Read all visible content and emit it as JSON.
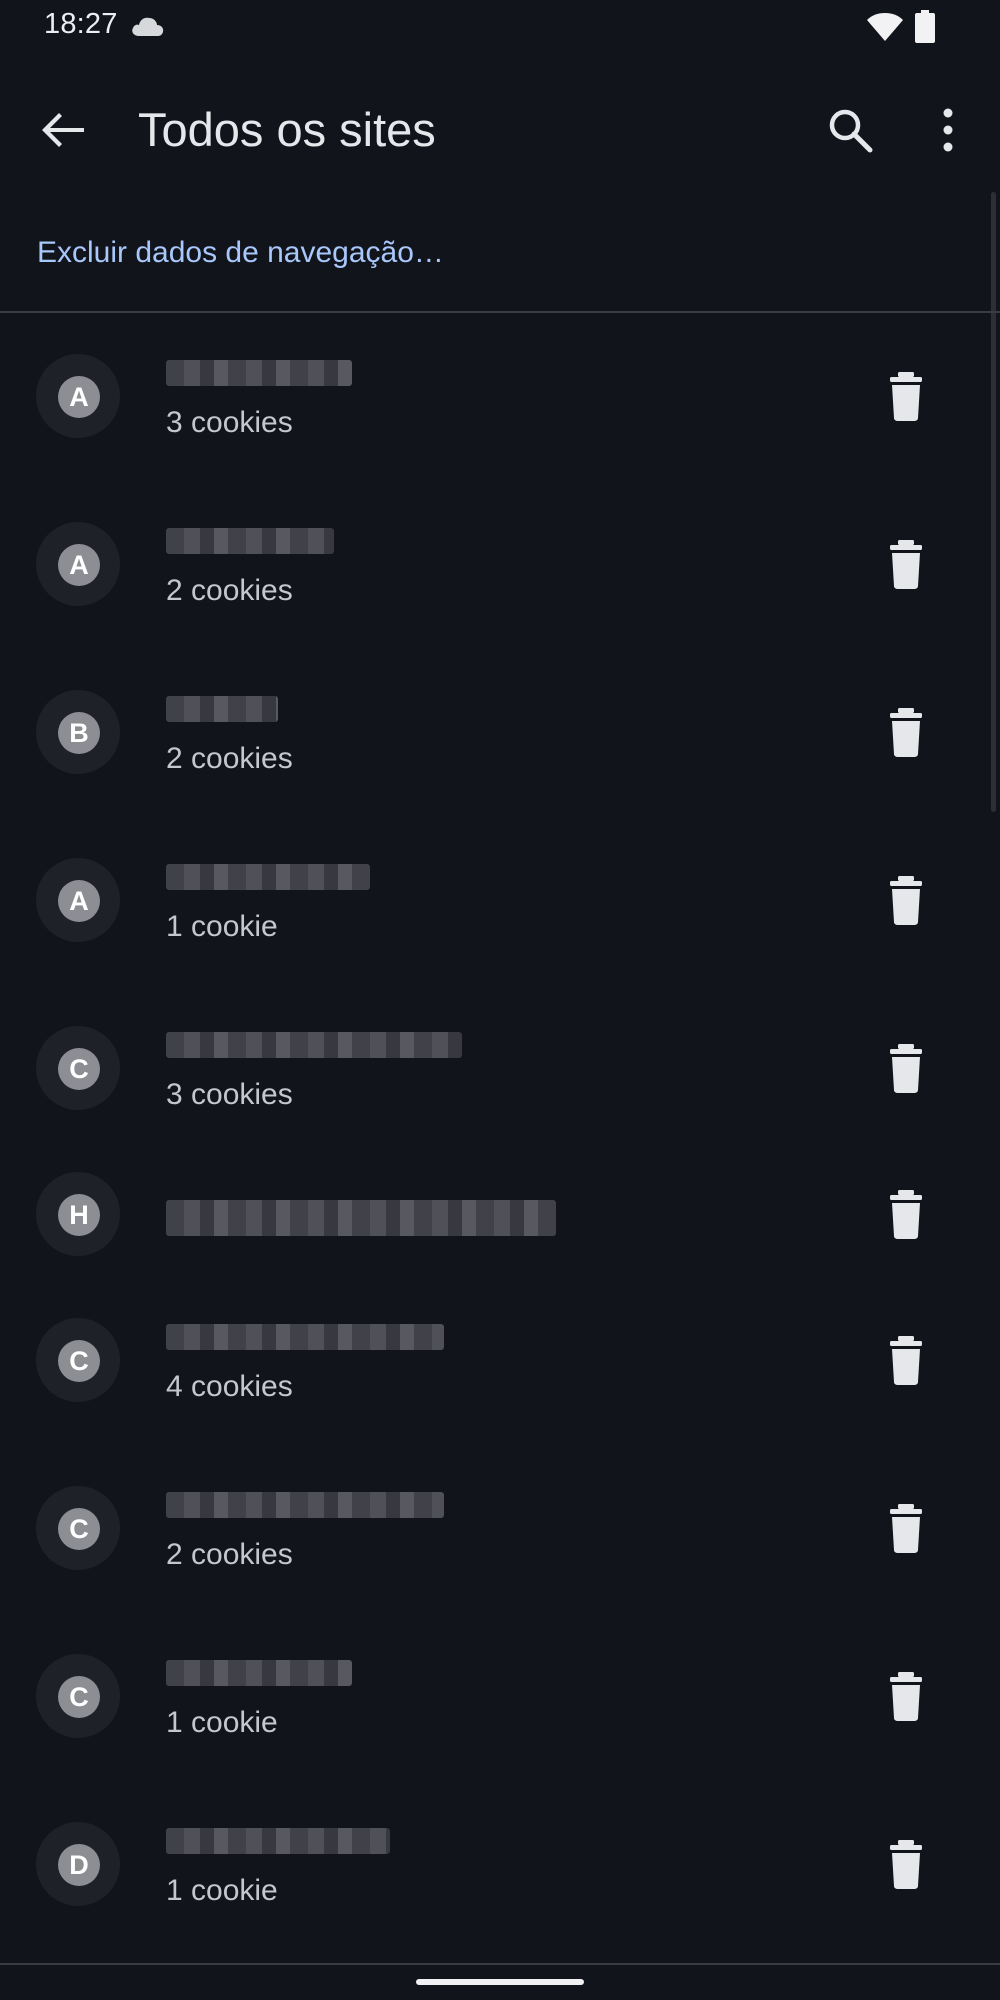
{
  "status_bar": {
    "time": "18:27",
    "icons": [
      "cloud-icon",
      "wifi-icon",
      "battery-icon"
    ]
  },
  "app_bar": {
    "title": "Todos os sites",
    "back_icon": "arrow-back-icon",
    "search_icon": "search-icon",
    "more_icon": "more-vert-icon"
  },
  "clear_browsing_data": "Excluir dados de navegação…",
  "sites": [
    {
      "initial": "A",
      "cookies": "3 cookies"
    },
    {
      "initial": "A",
      "cookies": "2 cookies"
    },
    {
      "initial": "B",
      "cookies": "2 cookies"
    },
    {
      "initial": "A",
      "cookies": "1 cookie"
    },
    {
      "initial": "C",
      "cookies": "3 cookies"
    },
    {
      "initial": "H",
      "cookies": ""
    },
    {
      "initial": "C",
      "cookies": "4 cookies"
    },
    {
      "initial": "C",
      "cookies": "2 cookies"
    },
    {
      "initial": "C",
      "cookies": "1 cookie"
    },
    {
      "initial": "D",
      "cookies": "1 cookie"
    }
  ],
  "colors": {
    "background": "#12141b",
    "link": "#a8c7fa",
    "avatar_circle": "#8d8e93",
    "text_primary": "#e6e7eb",
    "text_secondary": "#c6c7cc"
  }
}
